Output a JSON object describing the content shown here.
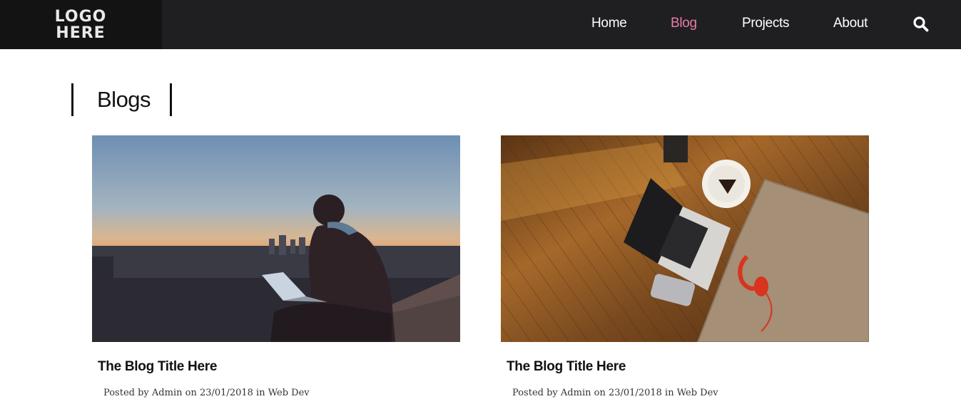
{
  "header": {
    "logo_line1": "LOGO",
    "logo_line2": "HERE",
    "nav": [
      {
        "label": "Home",
        "active": false
      },
      {
        "label": "Blog",
        "active": true
      },
      {
        "label": "Projects",
        "active": false
      },
      {
        "label": "About",
        "active": false
      }
    ],
    "search_icon": "search-icon",
    "active_color": "#e97aa8",
    "bar_color": "#1f1f22"
  },
  "main": {
    "heading": "Blogs",
    "posts": [
      {
        "image": "man-with-laptop-on-rooftop-at-sunset",
        "title": "The Blog Title Here",
        "meta_prefix": "Posted by",
        "author": "Admin",
        "meta_on": "on",
        "date": "23/01/2018",
        "meta_in": "in",
        "category": "Web Dev"
      },
      {
        "image": "laptop-phone-headphones-on-wood-floor",
        "title": "The Blog Title Here",
        "meta_prefix": "Posted by",
        "author": "Admin",
        "meta_on": "on",
        "date": "23/01/2018",
        "meta_in": "in",
        "category": "Web Dev"
      }
    ]
  }
}
